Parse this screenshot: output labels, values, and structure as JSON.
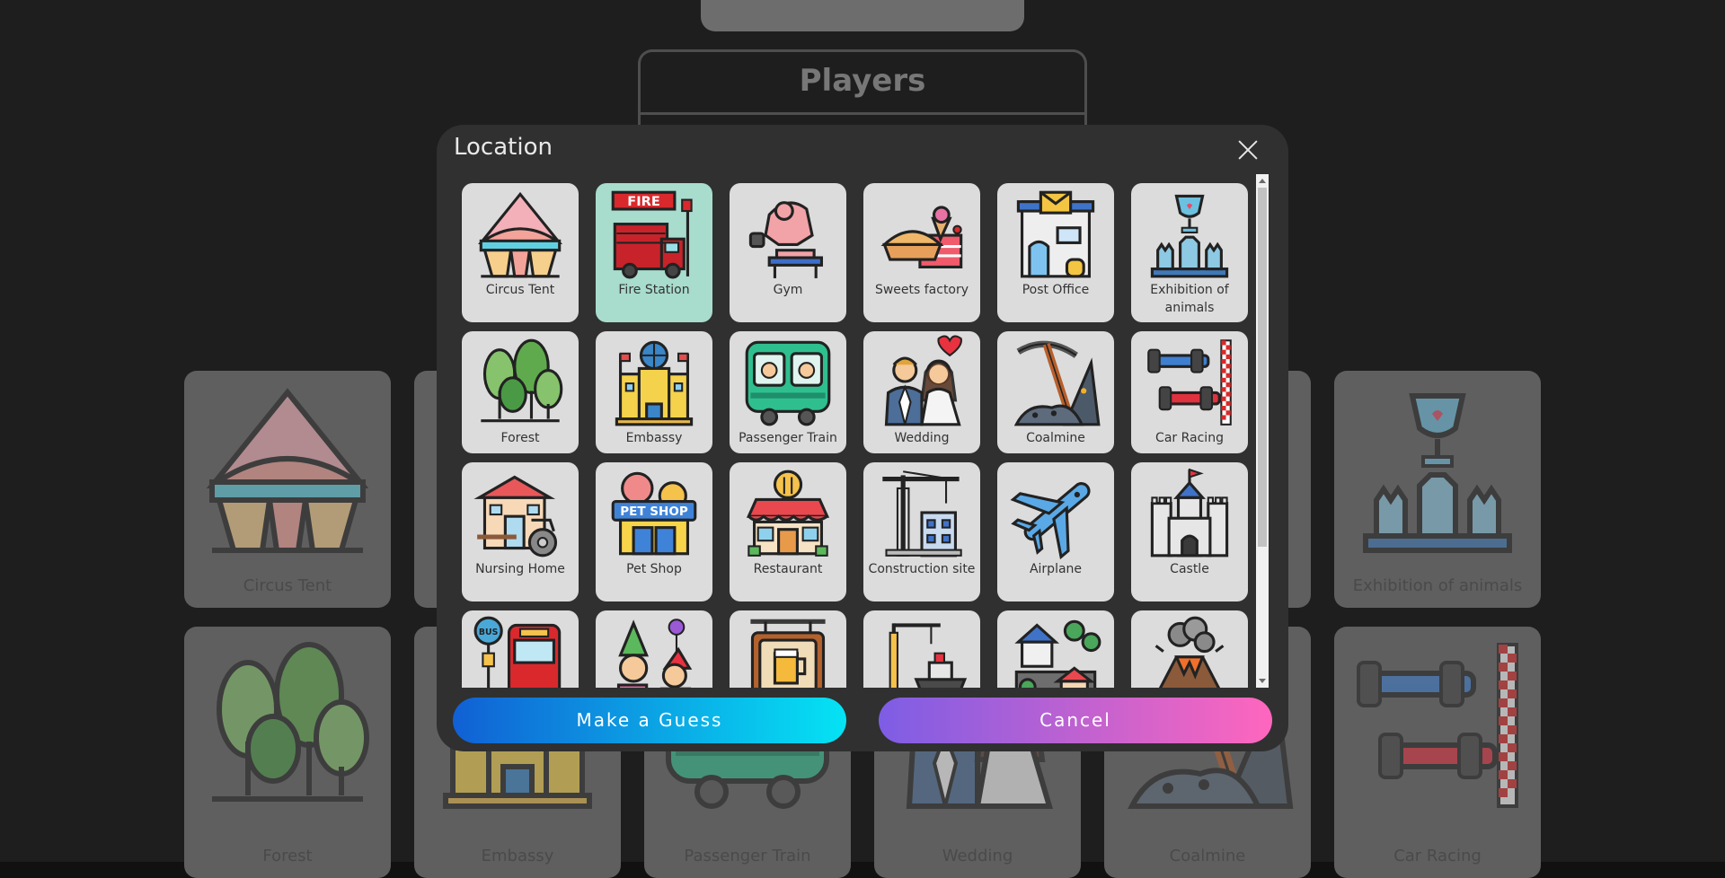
{
  "background": {
    "players_title": "Players",
    "cards": [
      {
        "label": "Circus Tent",
        "icon": "circus-tent-icon"
      },
      {
        "label": "Exhibition of animals",
        "icon": "exhibition-of-animals-icon"
      },
      {
        "label": "Forest",
        "icon": "forest-icon"
      },
      {
        "label": "Embassy",
        "icon": "embassy-icon"
      },
      {
        "label": "Passenger Train",
        "icon": "passenger-train-icon"
      },
      {
        "label": "Wedding",
        "icon": "wedding-icon"
      },
      {
        "label": "Coalmine",
        "icon": "coalmine-icon"
      },
      {
        "label": "Car Racing",
        "icon": "car-racing-icon"
      }
    ]
  },
  "modal": {
    "title": "Location",
    "close_icon": "close-icon",
    "selected": "Fire Station",
    "locations": [
      {
        "label": "Circus Tent",
        "icon": "circus-tent-icon"
      },
      {
        "label": "Fire Station",
        "icon": "fire-station-icon"
      },
      {
        "label": "Gym",
        "icon": "gym-icon"
      },
      {
        "label": "Sweets factory",
        "icon": "sweets-factory-icon"
      },
      {
        "label": "Post Office",
        "icon": "post-office-icon"
      },
      {
        "label": "Exhibition of animals",
        "icon": "exhibition-of-animals-icon"
      },
      {
        "label": "Forest",
        "icon": "forest-icon"
      },
      {
        "label": "Embassy",
        "icon": "embassy-icon"
      },
      {
        "label": "Passenger Train",
        "icon": "passenger-train-icon"
      },
      {
        "label": "Wedding",
        "icon": "wedding-icon"
      },
      {
        "label": "Coalmine",
        "icon": "coalmine-icon"
      },
      {
        "label": "Car Racing",
        "icon": "car-racing-icon"
      },
      {
        "label": "Nursing Home",
        "icon": "nursing-home-icon"
      },
      {
        "label": "Pet Shop",
        "icon": "pet-shop-icon"
      },
      {
        "label": "Restaurant",
        "icon": "restaurant-icon"
      },
      {
        "label": "Construction site",
        "icon": "construction-site-icon"
      },
      {
        "label": "Airplane",
        "icon": "airplane-icon"
      },
      {
        "label": "Castle",
        "icon": "castle-icon"
      },
      {
        "label": "",
        "icon": "bus-stop-icon"
      },
      {
        "label": "",
        "icon": "party-icon"
      },
      {
        "label": "",
        "icon": "pub-icon"
      },
      {
        "label": "",
        "icon": "port-icon"
      },
      {
        "label": "",
        "icon": "village-icon"
      },
      {
        "label": "",
        "icon": "volcano-icon"
      }
    ],
    "buttons": {
      "guess": "Make a Guess",
      "cancel": "Cancel"
    }
  },
  "colors": {
    "tile": "#dcdcdc",
    "tile_selected": "#a8dccd",
    "modal": "#303030",
    "guess_gradient": [
      "#1160d4",
      "#05e3f4"
    ],
    "cancel_gradient": [
      "#7d5de5",
      "#ff66bd"
    ]
  }
}
